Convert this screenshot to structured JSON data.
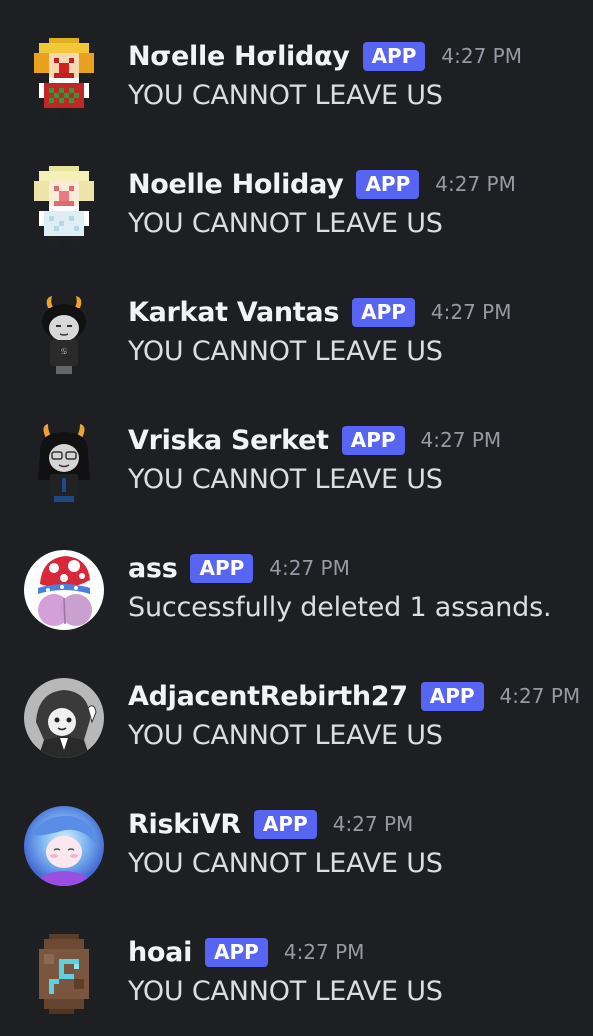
{
  "badge_label": "APP",
  "colors": {
    "background": "#1e1f23",
    "username": "#f2f3f5",
    "message_text": "#dbdee1",
    "timestamp": "#949ba4",
    "app_badge": "#5865f2"
  },
  "messages": [
    {
      "username": "Nσelle Hσlidαy",
      "timestamp": "4:27 PM",
      "content": "YOU CANNOT LEAVE US",
      "avatar_icon": "pixel-clown-avatar"
    },
    {
      "username": "Noelle Holiday",
      "timestamp": "4:27 PM",
      "content": "YOU CANNOT LEAVE US",
      "avatar_icon": "pixel-clown-pale-avatar"
    },
    {
      "username": "Karkat Vantas",
      "timestamp": "4:27 PM",
      "content": "YOU CANNOT LEAVE US",
      "avatar_icon": "troll-avatar"
    },
    {
      "username": "Vriska Serket",
      "timestamp": "4:27 PM",
      "content": "YOU CANNOT LEAVE US",
      "avatar_icon": "troll-glasses-avatar"
    },
    {
      "username": "ass",
      "timestamp": "4:27 PM",
      "content": "Successfully deleted 1 assands.",
      "avatar_icon": "mushroom-avatar"
    },
    {
      "username": "AdjacentRebirth27",
      "timestamp": "4:27 PM",
      "content": "YOU CANNOT LEAVE US",
      "avatar_icon": "anime-sketch-avatar"
    },
    {
      "username": "RiskiVR",
      "timestamp": "4:27 PM",
      "content": "YOU CANNOT LEAVE US",
      "avatar_icon": "anime-blue-avatar"
    },
    {
      "username": "hoai",
      "timestamp": "4:27 PM",
      "content": "YOU CANNOT LEAVE US",
      "avatar_icon": "pixel-rock-avatar"
    }
  ]
}
